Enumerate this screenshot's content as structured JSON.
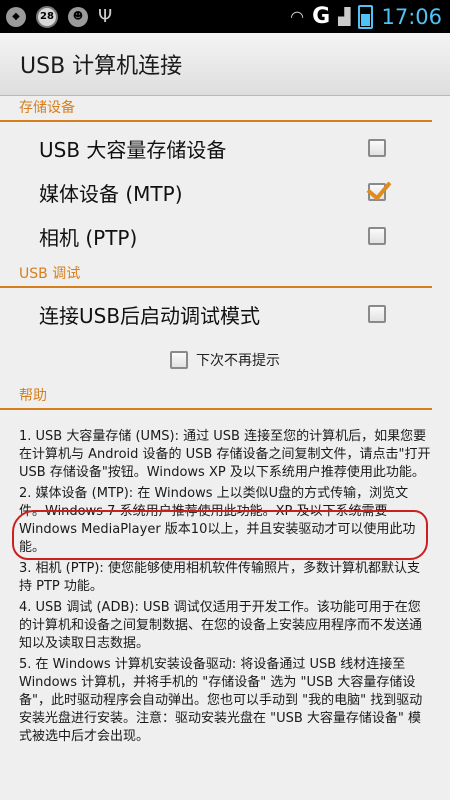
{
  "status_bar": {
    "notification_count": "28",
    "network_label": "G",
    "time": "17:06"
  },
  "title_bar": {
    "title": "USB 计算机连接"
  },
  "storage_section": {
    "header": "存储设备",
    "items": [
      {
        "label": "USB 大容量存储设备",
        "checked": false
      },
      {
        "label": "媒体设备 (MTP)",
        "checked": true
      },
      {
        "label": "相机 (PTP)",
        "checked": false
      }
    ]
  },
  "debug_section": {
    "header": "USB 调试",
    "items": [
      {
        "label": "连接USB后启动调试模式",
        "checked": false
      }
    ]
  },
  "dont_show": {
    "label": "下次不再提示",
    "checked": false
  },
  "help_section": {
    "header": "帮助",
    "paragraphs": [
      "1. USB 大容量存储 (UMS): 通过 USB 连接至您的计算机后，如果您要在计算机与 Android 设备的 USB 存储设备之间复制文件，请点击\"打开 USB 存储设备\"按钮。Windows XP 及以下系统用户推荐使用此功能。",
      "2. 媒体设备 (MTP): 在 Windows 上以类似U盘的方式传输，浏览文件。Windows 7 系统用户推荐使用此功能。XP 及以下系统需要 Windows MediaPlayer 版本10以上，并且安装驱动才可以使用此功能。",
      "3. 相机 (PTP): 使您能够使用相机软件传输照片，多数计算机都默认支持 PTP 功能。",
      "4. USB 调试 (ADB): USB 调试仅适用于开发工作。该功能可用于在您的计算机和设备之间复制数据、在您的设备上安装应用程序而不发送通知以及读取日志数据。",
      "5. 在 Windows 计算机安装设备驱动: 将设备通过 USB 线材连接至 Windows 计算机，并将手机的 \"存储设备\" 选为 \"USB 大容量存储设备\"，此时驱动程序会自动弹出。您也可以手动到 \"我的电脑\" 找到驱动安装光盘进行安装。注意：驱动安装光盘在 \"USB 大容量存储设备\" 模式被选中后才会出现。"
    ]
  },
  "colors": {
    "accent": "#d67f1c",
    "time": "#4fc3f7",
    "annotation": "#cc2020"
  }
}
